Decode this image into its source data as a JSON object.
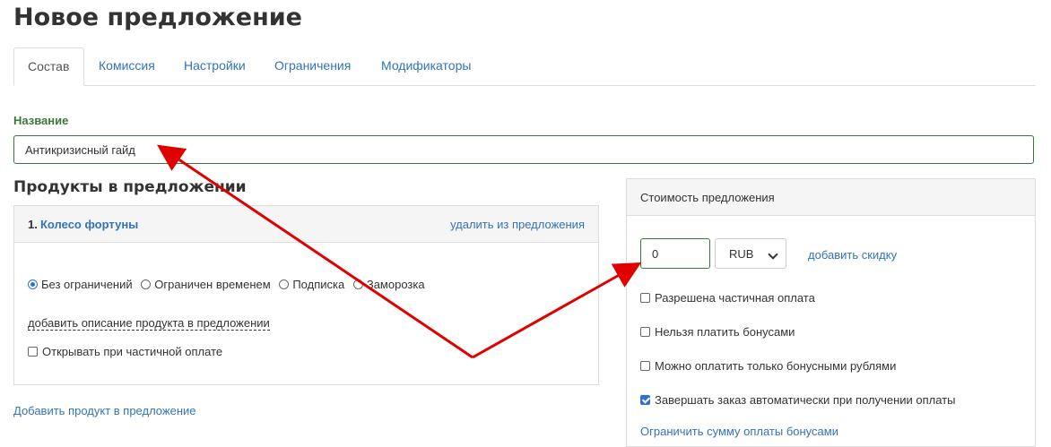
{
  "page_title": "Новое предложение",
  "tabs": [
    {
      "label": "Состав",
      "active": true
    },
    {
      "label": "Комиссия",
      "active": false
    },
    {
      "label": "Настройки",
      "active": false
    },
    {
      "label": "Ограничения",
      "active": false
    },
    {
      "label": "Модификаторы",
      "active": false
    }
  ],
  "name_field": {
    "label": "Название",
    "value": "Антикризисный гайд"
  },
  "products": {
    "title": "Продукты в предложении",
    "item": {
      "number": "1.",
      "name": "Колесо фортуны",
      "remove_label": "удалить из предложения",
      "radios": [
        {
          "label": "Без ограничений",
          "checked": true
        },
        {
          "label": "Ограничен временем",
          "checked": false
        },
        {
          "label": "Подписка",
          "checked": false
        },
        {
          "label": "Заморозка",
          "checked": false
        }
      ],
      "description_link": "добавить описание продукта в предложении",
      "partial_payment_checkbox": {
        "label": "Открывать при частичной оплате",
        "checked": false
      }
    },
    "add_product_label": "Добавить продукт в предложение"
  },
  "pricing": {
    "title": "Стоимость предложения",
    "price_value": "0",
    "currency": "RUB",
    "add_discount_label": "добавить скидку",
    "options": [
      {
        "label": "Разрешена частичная оплата",
        "checked": false
      },
      {
        "label": "Нельзя платить бонусами",
        "checked": false
      },
      {
        "label": "Можно оплатить только бонусными рублями",
        "checked": false
      },
      {
        "label": "Завершать заказ автоматически при получении оплаты",
        "checked": true
      }
    ],
    "limit_bonus_link": "Ограничить сумму оплаты бонусами"
  },
  "colors": {
    "link": "#3373b7",
    "success": "#3c763d",
    "annotation_arrow": "#e00000",
    "checkbox_checked": "#2f6fd6"
  }
}
